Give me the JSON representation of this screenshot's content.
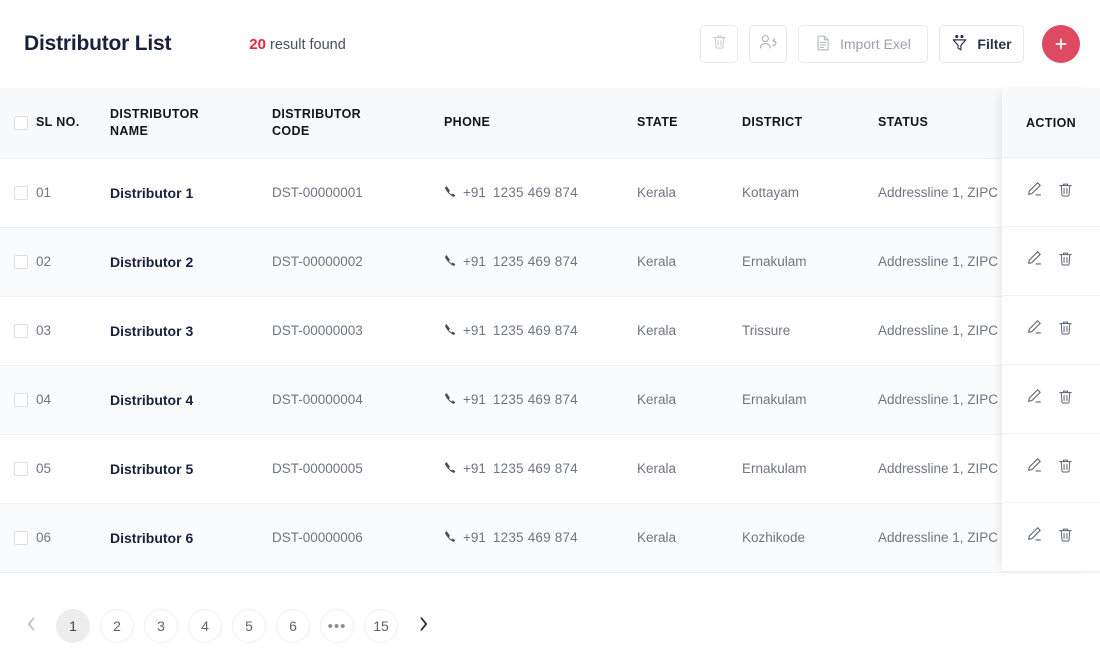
{
  "header": {
    "title": "Distributor List",
    "result_count": "20",
    "result_label": "result found",
    "accent_color": "#e8273f",
    "fab_color": "#dd4a62"
  },
  "toolbar": {
    "delete_icon": "trash-icon",
    "assign_user_icon": "user-assign-icon",
    "import_label": "Import Exel",
    "import_icon": "document-icon",
    "filter_label": "Filter",
    "filter_icon": "funnel-icon",
    "add_label": "+"
  },
  "table": {
    "columns": [
      "SL NO.",
      "DISTRIBUTOR NAME",
      "DISTRIBUTOR CODE",
      "PHONE",
      "STATE",
      "DISTRICT",
      "STATUS",
      "ACTION"
    ],
    "column_lines": {
      "sl": [
        "SL NO."
      ],
      "name": [
        "DISTRIBUTOR",
        "NAME"
      ],
      "code": [
        "DISTRIBUTOR",
        "CODE"
      ],
      "phone": [
        "PHONE"
      ],
      "state": [
        "STATE"
      ],
      "district": [
        "DISTRICT"
      ],
      "status": [
        "STATUS"
      ],
      "action": [
        "ACTION"
      ]
    },
    "rows": [
      {
        "sl": "01",
        "name": "Distributor 1",
        "code": "DST-00000001",
        "phone_prefix": "+91",
        "phone": "1235 469 874",
        "state": "Kerala",
        "district": "Kottayam",
        "status": "Addressline 1, ZIPC"
      },
      {
        "sl": "02",
        "name": "Distributor 2",
        "code": "DST-00000002",
        "phone_prefix": "+91",
        "phone": "1235 469 874",
        "state": "Kerala",
        "district": "Ernakulam",
        "status": "Addressline 1, ZIPC"
      },
      {
        "sl": "03",
        "name": "Distributor 3",
        "code": "DST-00000003",
        "phone_prefix": "+91",
        "phone": "1235 469 874",
        "state": "Kerala",
        "district": "Trissure",
        "status": "Addressline 1, ZIPC"
      },
      {
        "sl": "04",
        "name": "Distributor 4",
        "code": "DST-00000004",
        "phone_prefix": "+91",
        "phone": "1235 469 874",
        "state": "Kerala",
        "district": "Ernakulam",
        "status": "Addressline 1, ZIPC"
      },
      {
        "sl": "05",
        "name": "Distributor 5",
        "code": "DST-00000005",
        "phone_prefix": "+91",
        "phone": "1235 469 874",
        "state": "Kerala",
        "district": "Ernakulam",
        "status": "Addressline 1, ZIPC"
      },
      {
        "sl": "06",
        "name": "Distributor 6",
        "code": "DST-00000006",
        "phone_prefix": "+91",
        "phone": "1235 469 874",
        "state": "Kerala",
        "district": "Kozhikode",
        "status": "Addressline 1, ZIPC"
      }
    ],
    "row_actions": {
      "edit_icon": "pencil-edit-icon",
      "delete_icon": "trash-icon"
    }
  },
  "pagination": {
    "prev_icon": "chevron-left-icon",
    "next_icon": "chevron-right-icon",
    "pages": [
      "1",
      "2",
      "3",
      "4",
      "5",
      "6",
      "•••",
      "15"
    ],
    "active_page": "1"
  }
}
